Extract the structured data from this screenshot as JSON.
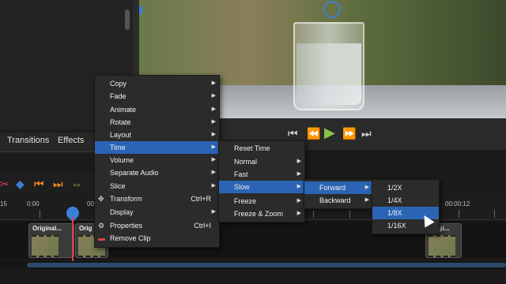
{
  "tabs": {
    "transitions": "Transitions",
    "effects": "Effects"
  },
  "ruler": {
    "labels": [
      "15",
      "0:00",
      "00:",
      "00:00:12"
    ]
  },
  "clips": [
    {
      "title": "Original..."
    },
    {
      "title": "Orig"
    },
    {
      "title": "Origi..."
    }
  ],
  "menu1": {
    "items": [
      {
        "label": "Copy",
        "submenu": true
      },
      {
        "label": "Fade",
        "submenu": true
      },
      {
        "label": "Animate",
        "submenu": true
      },
      {
        "label": "Rotate",
        "submenu": true
      },
      {
        "label": "Layout",
        "submenu": true
      },
      {
        "label": "Time",
        "submenu": true,
        "highlighted": true
      },
      {
        "label": "Volume",
        "submenu": true
      },
      {
        "label": "Separate Audio",
        "submenu": true
      },
      {
        "label": "Slice",
        "submenu": true
      },
      {
        "label": "Transform",
        "shortcut": "Ctrl+R",
        "icon": "move-icon"
      },
      {
        "label": "Display",
        "submenu": true
      },
      {
        "label": "Properties",
        "shortcut": "Ctrl+I",
        "icon": "gear-icon"
      },
      {
        "label": "Remove Clip",
        "icon": "remove-icon"
      }
    ]
  },
  "menu2": {
    "items": [
      {
        "label": "Reset Time"
      },
      {
        "label": "Normal",
        "submenu": true
      },
      {
        "label": "Fast",
        "submenu": true
      },
      {
        "label": "Slow",
        "submenu": true,
        "highlighted": true
      },
      {
        "label": "Freeze",
        "submenu": true
      },
      {
        "label": "Freeze & Zoom",
        "submenu": true
      }
    ]
  },
  "menu3": {
    "items": [
      {
        "label": "Forward",
        "submenu": true,
        "highlighted": true
      },
      {
        "label": "Backward",
        "submenu": true
      }
    ]
  },
  "menu4": {
    "items": [
      {
        "label": "1/2X"
      },
      {
        "label": "1/4X"
      },
      {
        "label": "1/8X",
        "highlighted": true
      },
      {
        "label": "1/16X"
      }
    ]
  },
  "colors": {
    "accent": "#2b64b4",
    "play": "#8bc34a",
    "playhead": "#d9424b"
  }
}
